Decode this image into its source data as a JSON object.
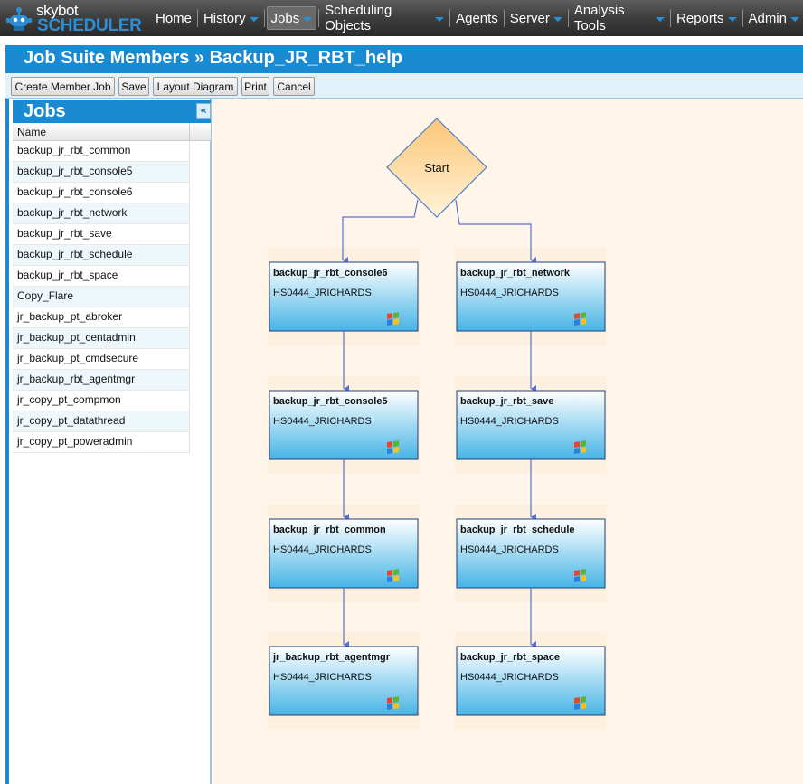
{
  "logo": {
    "top": "skybot",
    "bottom": "SCHEDULER"
  },
  "nav": [
    {
      "label": "Home",
      "dropdown": false
    },
    {
      "label": "History",
      "dropdown": true
    },
    {
      "label": "Jobs",
      "dropdown": true,
      "active": true
    },
    {
      "label": "Scheduling Objects",
      "dropdown": true
    },
    {
      "label": "Agents",
      "dropdown": false
    },
    {
      "label": "Server",
      "dropdown": true
    },
    {
      "label": "Analysis Tools",
      "dropdown": true
    },
    {
      "label": "Reports",
      "dropdown": true
    },
    {
      "label": "Admin",
      "dropdown": true
    }
  ],
  "page": {
    "title": "Job Suite Members » Backup_JR_RBT_help"
  },
  "toolbar": {
    "create_member_job": "Create Member Job",
    "save": "Save",
    "layout_diagram": "Layout Diagram",
    "print": "Print",
    "cancel": "Cancel"
  },
  "jobs_panel": {
    "title": "Jobs",
    "collapse_icon": "double-chevron-left-icon",
    "column_name": "Name",
    "items": [
      "backup_jr_rbt_common",
      "backup_jr_rbt_console5",
      "backup_jr_rbt_console6",
      "backup_jr_rbt_network",
      "backup_jr_rbt_save",
      "backup_jr_rbt_schedule",
      "backup_jr_rbt_space",
      "Copy_Flare",
      "jr_backup_pt_abroker",
      "jr_backup_pt_centadmin",
      "jr_backup_pt_cmdsecure",
      "jr_backup_rbt_agentmgr",
      "jr_copy_pt_compmon",
      "jr_copy_pt_datathread",
      "jr_copy_pt_poweradmin"
    ]
  },
  "diagram": {
    "start_label": "Start",
    "columns": [
      [
        {
          "name": "backup_jr_rbt_console6",
          "agent": "HS0444_JRICHARDS"
        },
        {
          "name": "backup_jr_rbt_console5",
          "agent": "HS0444_JRICHARDS"
        },
        {
          "name": "backup_jr_rbt_common",
          "agent": "HS0444_JRICHARDS"
        },
        {
          "name": "jr_backup_rbt_agentmgr",
          "agent": "HS0444_JRICHARDS"
        }
      ],
      [
        {
          "name": "backup_jr_rbt_network",
          "agent": "HS0444_JRICHARDS"
        },
        {
          "name": "backup_jr_rbt_save",
          "agent": "HS0444_JRICHARDS"
        },
        {
          "name": "backup_jr_rbt_schedule",
          "agent": "HS0444_JRICHARDS"
        },
        {
          "name": "backup_jr_rbt_space",
          "agent": "HS0444_JRICHARDS"
        }
      ]
    ],
    "node_icon": "windows-icon",
    "colors": {
      "arrow": "#5a6fd6",
      "node_border": "#1f3f7a",
      "start_fill": "#fbc676"
    }
  }
}
